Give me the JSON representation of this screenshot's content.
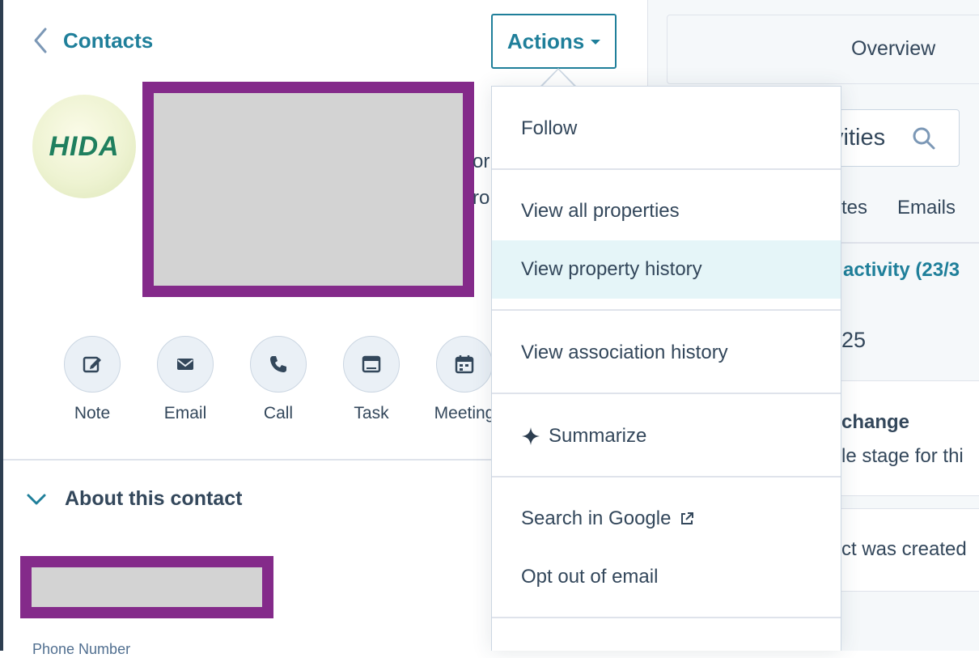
{
  "header": {
    "back_label": "Contacts",
    "actions_label": "Actions"
  },
  "contact": {
    "avatar_text": "HIDA",
    "peek_line1": "or",
    "peek_line2": "ro"
  },
  "quick_actions": [
    {
      "label": "Note",
      "icon": "note-icon"
    },
    {
      "label": "Email",
      "icon": "email-icon"
    },
    {
      "label": "Call",
      "icon": "call-icon"
    },
    {
      "label": "Task",
      "icon": "task-icon"
    },
    {
      "label": "Meeting",
      "icon": "meeting-icon"
    }
  ],
  "about": {
    "title": "About this contact",
    "phone_label": "Phone Number"
  },
  "menu": {
    "items": [
      {
        "label": "Follow"
      },
      {
        "label": "View all properties"
      },
      {
        "label": "View property history",
        "highlighted": true
      },
      {
        "label": "View association history"
      },
      {
        "label": "Summarize",
        "icon": "sparkle-icon"
      },
      {
        "label": "Search in Google",
        "icon": "external-link-icon"
      },
      {
        "label": "Opt out of email"
      }
    ]
  },
  "right": {
    "overview_label": "Overview",
    "search_text": "vities",
    "tabs": [
      "tes",
      "Emails"
    ],
    "activity_header": "activity (23/3",
    "date_fragment": "25",
    "card1_title": "change",
    "card1_sub": "le stage for thi",
    "card2_text": "ct was created"
  },
  "colors": {
    "accent": "#1f7f9a",
    "redaction_border": "#842a8a",
    "redaction_fill": "#d3d3d3",
    "menu_highlight": "#e5f5f8"
  }
}
